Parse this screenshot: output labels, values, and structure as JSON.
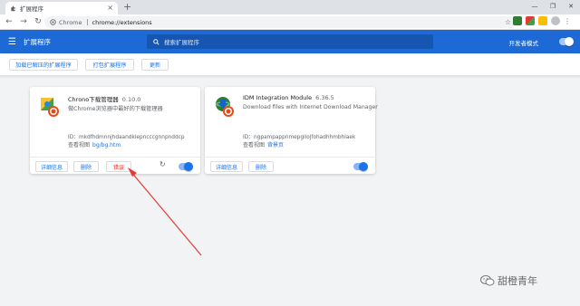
{
  "tab": {
    "title": "扩展程序",
    "icon": "puzzle-icon"
  },
  "omnibox": {
    "scheme": "Chrome",
    "url": "chrome://extensions"
  },
  "header": {
    "title": "扩展程序",
    "search_placeholder": "搜索扩展程序",
    "dev_mode_label": "开发者模式",
    "dev_mode_on": true
  },
  "toolbar_buttons": {
    "load_unpacked": "加载已解压的扩展程序",
    "pack": "打包扩展程序",
    "update": "更新"
  },
  "cards": [
    {
      "name": "Chrono下载管理器",
      "version": "0.10.0",
      "description": "做Chrome浏览器中最好的下载管理器",
      "id": "ID：mkdfhdmnnjhdaandklepncccgnnpnddcp",
      "view_label": "查看视图",
      "view_link": "bg/bg.htm",
      "details": "详细信息",
      "remove": "删除",
      "errors": "错误",
      "enabled": true
    },
    {
      "name": "IDM Integration Module",
      "version": "6.36.5",
      "description": "Download files with Internet Download Manager",
      "id": "ID：ngpampappnmepgilojfohadhhmbhlaek",
      "view_label": "查看视图",
      "view_link": "背景页",
      "details": "详细信息",
      "remove": "删除",
      "enabled": true
    }
  ],
  "annotation": {
    "color": "#e53935"
  },
  "watermark": {
    "text": "甜橙青年",
    "icon": "wechat-icon"
  },
  "colors": {
    "header_blue": "#1d6ad6",
    "link_blue": "#1a73e8",
    "error_red": "#d93025"
  }
}
